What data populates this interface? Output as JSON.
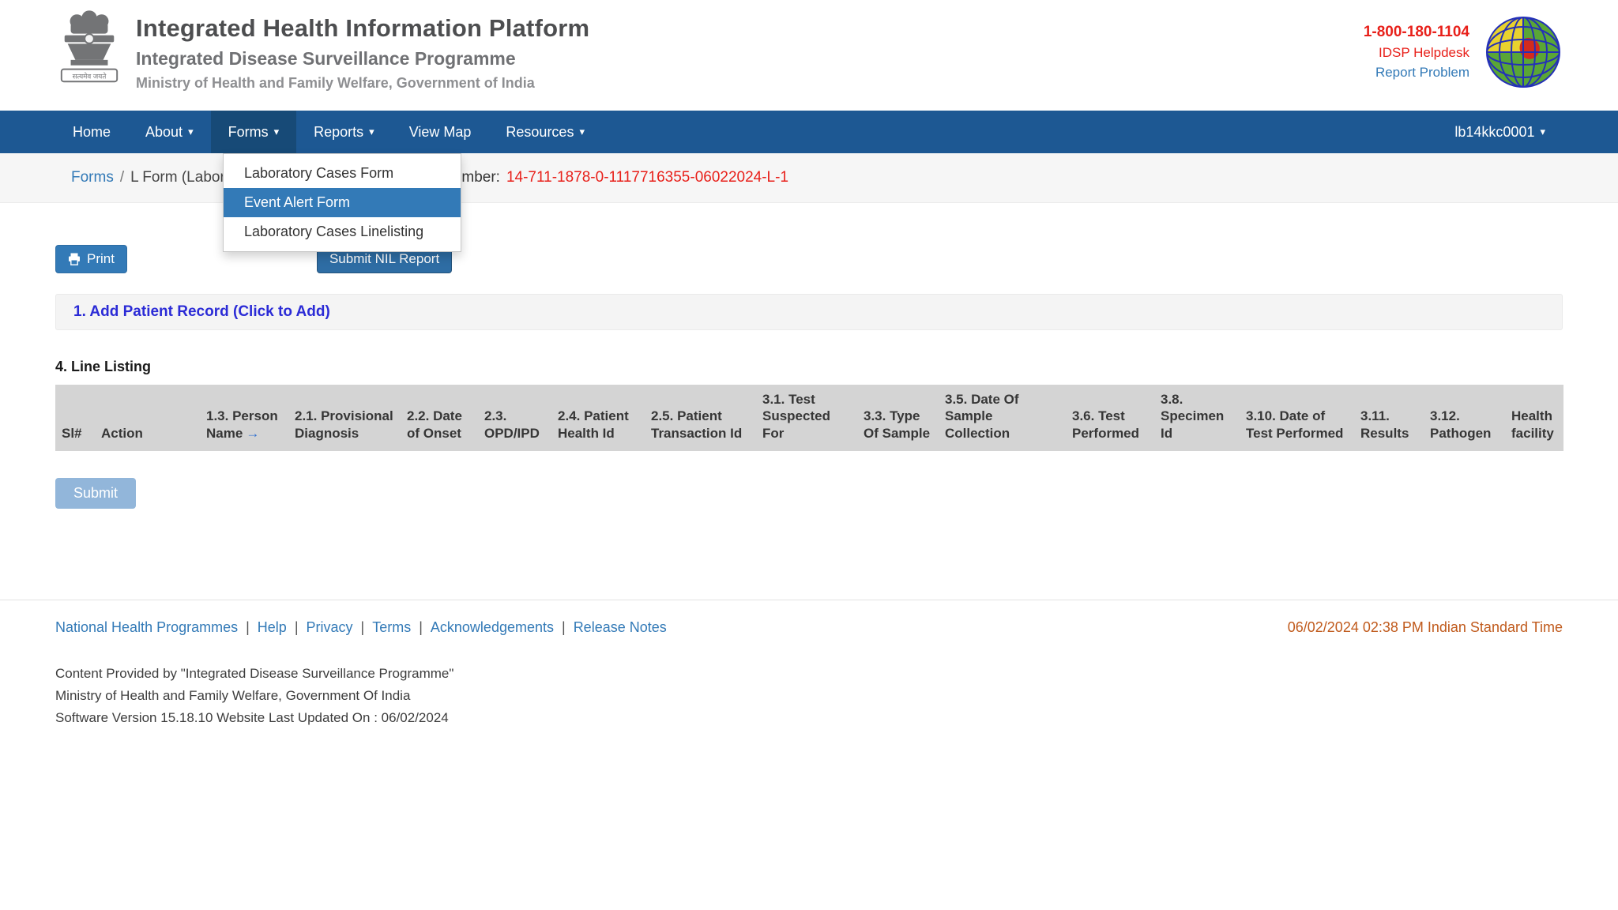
{
  "header": {
    "title": "Integrated Health Information Platform",
    "subtitle": "Integrated Disease Surveillance Programme",
    "ministry": "Ministry of Health and Family Welfare, Government of India",
    "helpdesk_phone": "1-800-180-1104",
    "helpdesk_label": "IDSP Helpdesk",
    "report_problem": "Report Problem",
    "emblem_motto": "सत्यमेव जयते"
  },
  "nav": {
    "items": [
      {
        "label": "Home"
      },
      {
        "label": "About"
      },
      {
        "label": "Forms"
      },
      {
        "label": "Reports"
      },
      {
        "label": "View Map"
      },
      {
        "label": "Resources"
      }
    ],
    "user": "lb14kkc0001"
  },
  "icons": {
    "caret": "▾",
    "arrow_right": "→",
    "separator_slash": "/",
    "separator_pipe": "|"
  },
  "dropdown": {
    "items": [
      "Laboratory Cases Form",
      "Event Alert Form",
      "Laboratory Cases Linelisting"
    ],
    "active": "Event Alert Form"
  },
  "breadcrumb": {
    "link": "Forms",
    "current": "L Form (Laboratory Cases Form)",
    "number_label": "Number:",
    "number_value": "14-711-1878-0-1117716355-06022024-L-1"
  },
  "toolbar": {
    "print_label": "Print",
    "nil_report_label": "Submit NIL Report"
  },
  "patient_section": {
    "title": "1. Add Patient Record (Click to Add)"
  },
  "line_listing": {
    "heading": "4. Line Listing",
    "columns": [
      "Sl#",
      "Action",
      "1.3. Person Name",
      "2.1. Provisional Diagnosis",
      "2.2. Date of Onset",
      "2.3. OPD/IPD",
      "2.4. Patient Health Id",
      "2.5. Patient Transaction Id",
      "3.1. Test Suspected For",
      "3.3. Type Of Sample",
      "3.5. Date Of Sample Collection",
      "3.6. Test Performed",
      "3.8. Specimen Id",
      "3.10. Date of Test Performed",
      "3.11. Results",
      "3.12. Pathogen",
      "Health facility"
    ],
    "rows": []
  },
  "submit": {
    "label": "Submit"
  },
  "footer": {
    "links": [
      "National Health Programmes",
      "Help",
      "Privacy",
      "Terms",
      "Acknowledgements",
      "Release Notes"
    ],
    "timestamp": "06/02/2024 02:38 PM Indian Standard Time",
    "content_line1": "Content Provided by \"Integrated Disease Surveillance Programme\"",
    "content_line2": "Ministry of Health and Family Welfare, Government Of India",
    "content_line3": "Software Version 15.18.10  Website Last Updated On :  06/02/2024"
  },
  "colors": {
    "navbar_blue": "#1d5893",
    "nav_open_blue": "#174a77",
    "link_blue": "#337ab7",
    "dropdown_active_blue": "#337ab7",
    "alert_red": "#e8201a",
    "timestamp_orange": "#c05a1c",
    "table_header_gray": "#d4d4d4",
    "section_text_blue": "#2b2bd6",
    "submit_disabled_blue": "#92b6da"
  }
}
